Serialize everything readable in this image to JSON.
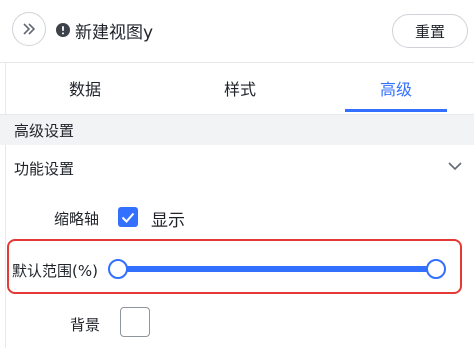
{
  "header": {
    "expand_icon": "double-chevron-right-icon",
    "info_icon": "exclamation-circle-icon",
    "title": "新建视图y",
    "reset_label": "重置"
  },
  "tabs": [
    {
      "label": "数据",
      "active": false
    },
    {
      "label": "样式",
      "active": false
    },
    {
      "label": "高级",
      "active": true
    }
  ],
  "accent_color": "#3370ff",
  "highlight_color": "#e53935",
  "section": {
    "title": "高级设置"
  },
  "group": {
    "title": "功能设置",
    "icon": "chevron-down-icon",
    "expanded": true
  },
  "settings": {
    "thumbnail_axis": {
      "label": "缩略轴",
      "option_label": "显示",
      "checked": true
    },
    "default_range": {
      "label": "默认范围(%)",
      "start": 0,
      "end": 100
    },
    "background": {
      "label": "背景",
      "checked": false
    }
  }
}
